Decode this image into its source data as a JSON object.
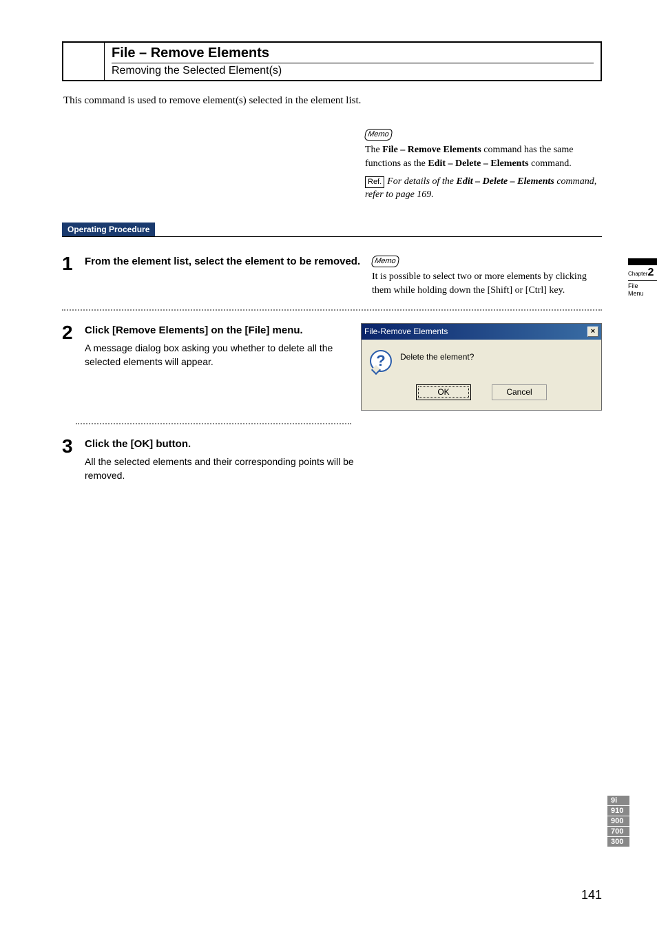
{
  "title": {
    "main": "File – Remove Elements",
    "sub": "Removing the Selected Element(s)"
  },
  "intro": "This command is used to remove element(s) selected in the element list.",
  "memo1": {
    "label": "Memo",
    "text_prefix": "The ",
    "text_bold1": "File – Remove Elements",
    "text_mid": " command has the same functions as the ",
    "text_bold2": "Edit – Delete – Elements",
    "text_suffix": " command."
  },
  "ref1": {
    "label": "Ref.",
    "text_prefix": "For details of the ",
    "text_bold": "Edit – Delete – Elements",
    "text_suffix": " command, refer to page 169."
  },
  "op_procedure_label": "Operating Procedure",
  "steps": {
    "s1": {
      "num": "1",
      "title": "From the element list, select the element to be removed."
    },
    "s1_memo": {
      "label": "Memo",
      "text": "It is possible to select two or more elements by clicking them while holding down the [Shift] or [Ctrl] key."
    },
    "s2": {
      "num": "2",
      "title": "Click [Remove Elements] on the [File] menu.",
      "desc": "A message dialog box asking you whether to delete all the selected elements will appear."
    },
    "s3": {
      "num": "3",
      "title": "Click the [OK] button.",
      "desc": "All the selected elements and their corresponding points will be removed."
    }
  },
  "dialog": {
    "title": "File-Remove Elements",
    "close": "×",
    "icon": "?",
    "message": "Delete the element?",
    "ok": "OK",
    "cancel": "Cancel"
  },
  "chapter": {
    "prefix": "Chapter",
    "num": "2",
    "line1": "File",
    "line2": "Menu"
  },
  "side_nums": [
    "9i",
    "910",
    "900",
    "700",
    "300"
  ],
  "page_number": "141"
}
